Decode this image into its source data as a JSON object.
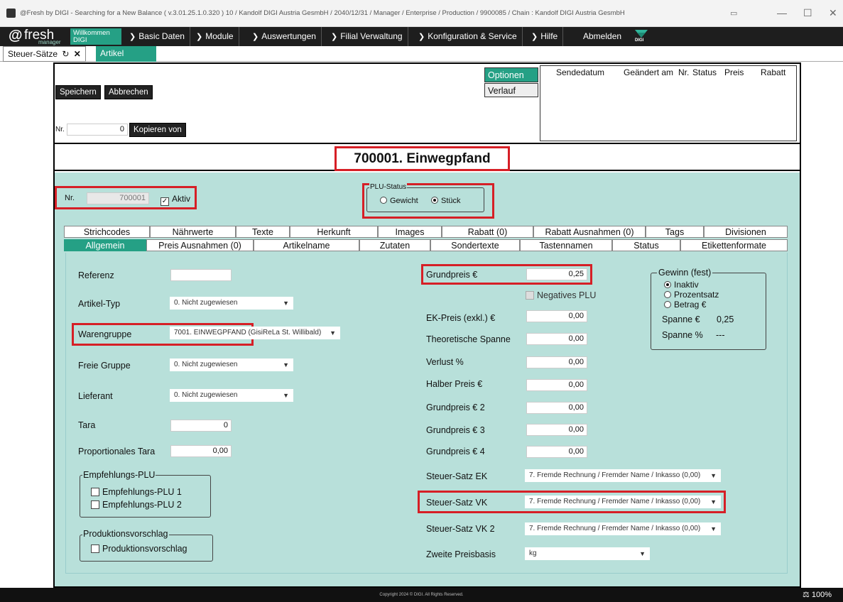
{
  "window": {
    "title": "@Fresh by DIGI - Searching for a New Balance ( v.3.01.25.1.0.320 ) 10 / Kandolf DIGI Austria GesmbH / 2040/12/31 / Manager / Enterprise / Production / 9900085 /     Chain : Kandolf DIGI Austria GesmbH"
  },
  "logo": {
    "at": "@",
    "fresh": "fresh",
    "manager": "manager"
  },
  "menu": {
    "welcome_line1": "Willkommen",
    "welcome_line2": "DIGI",
    "items": [
      "Basic Daten",
      "Module",
      "Auswertungen",
      "Filial Verwaltung",
      "Konfiguration & Service",
      "Hilfe"
    ],
    "logout": "Abmelden",
    "digi_brand": "DIGI"
  },
  "doc_tabs": {
    "tab1": "Steuer-Sätze",
    "tab2": "Artikel"
  },
  "toolbar": {
    "save": "Speichern",
    "cancel": "Abbrechen",
    "nr_label": "Nr.",
    "nr_value": "0",
    "copy_from": "Kopieren von"
  },
  "options_panel": {
    "options": "Optionen",
    "history": "Verlauf",
    "columns": [
      "Sendedatum",
      "Geändert am",
      "Nr.",
      "Status",
      "Preis",
      "Rabatt"
    ]
  },
  "article_title": "700001. Einwegpfand",
  "header_fields": {
    "nr_label": "Nr.",
    "nr_value": "700001",
    "active_label": "Aktiv",
    "plu_status_legend": "PLU-Status",
    "weight": "Gewicht",
    "piece": "Stück"
  },
  "subtabs_row1": [
    "Strichcodes",
    "Nährwerte",
    "Texte",
    "Herkunft",
    "Images",
    "Rabatt (0)",
    "Rabatt Ausnahmen (0)",
    "Tags",
    "Divisionen"
  ],
  "subtabs_row2": [
    "Allgemein",
    "Preis Ausnahmen (0)",
    "Artikelname",
    "Zutaten",
    "Sondertexte",
    "Tastennamen",
    "Status",
    "Etikettenformate"
  ],
  "left": {
    "reference": "Referenz",
    "reference_value": "",
    "article_type": "Artikel-Typ",
    "article_type_value": "0. Nicht zugewiesen",
    "product_group": "Warengruppe",
    "product_group_value": "7001. EINWEGPFAND (GisiReLa St. Willibald)",
    "free_group": "Freie Gruppe",
    "free_group_value": "0. Nicht zugewiesen",
    "supplier": "Lieferant",
    "supplier_value": "0. Nicht zugewiesen",
    "tare": "Tara",
    "tare_value": "0",
    "prop_tare": "Proportionales Tara",
    "prop_tare_value": "0,00",
    "rec_plu_legend": "Empfehlungs-PLU",
    "rec_plu_1": "Empfehlungs-PLU 1",
    "rec_plu_2": "Empfehlungs-PLU 2",
    "prod_suggestion_legend": "Produktionsvorschlag",
    "prod_suggestion": "Produktionsvorschlag"
  },
  "middle": {
    "base_price": "Grundpreis €",
    "base_price_value": "0,25",
    "negative_plu": "Negatives PLU",
    "purchase_price": "EK-Preis (exkl.) €",
    "purchase_price_value": "0,00",
    "theoretical_margin": "Theoretische Spanne",
    "theoretical_margin_value": "0,00",
    "loss": "Verlust %",
    "loss_value": "0,00",
    "half_price": "Halber Preis €",
    "half_price_value": "0,00",
    "base_price_2": "Grundpreis € 2",
    "base_price_2_value": "0,00",
    "base_price_3": "Grundpreis € 3",
    "base_price_3_value": "0,00",
    "base_price_4": "Grundpreis € 4",
    "base_price_4_value": "0,00",
    "tax_ek": "Steuer-Satz EK",
    "tax_ek_value": "7. Fremde Rechnung / Fremder Name / Inkasso (0,00)",
    "tax_vk": "Steuer-Satz VK",
    "tax_vk_value": "7. Fremde Rechnung / Fremder Name / Inkasso (0,00)",
    "tax_vk2": "Steuer-Satz VK 2",
    "tax_vk2_value": "7. Fremde Rechnung / Fremder Name / Inkasso (0,00)",
    "second_price_basis": "Zweite Preisbasis",
    "second_price_basis_value": "kg"
  },
  "profit": {
    "legend": "Gewinn (fest)",
    "inactive": "Inaktiv",
    "percent": "Prozentsatz",
    "amount": "Betrag €",
    "margin_eur": "Spanne €",
    "margin_eur_value": "0,25",
    "margin_pct": "Spanne %",
    "margin_pct_value": "---"
  },
  "footer": {
    "copyright": "Copyright 2024 © DIGI. All Rights Reserved.",
    "zoom": "100%"
  },
  "colors": {
    "teal": "#b8e0da",
    "accent": "#25a085",
    "highlight": "#d61f26"
  }
}
